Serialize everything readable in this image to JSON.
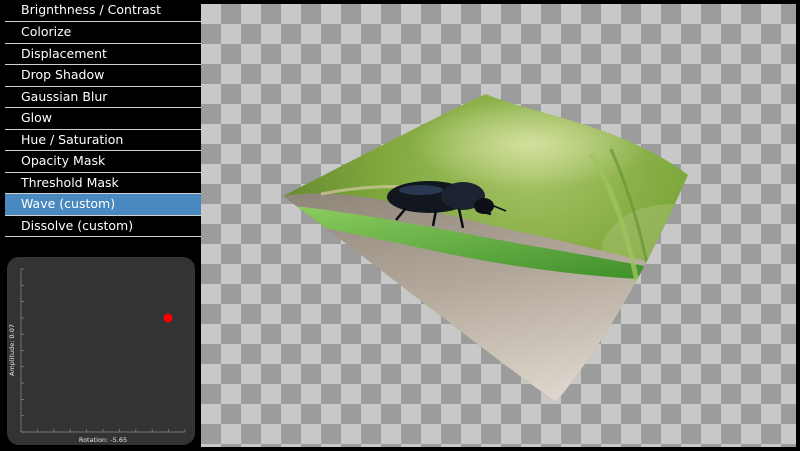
{
  "effects": {
    "items": [
      {
        "label": "Brignthness / Contrast",
        "selected": false
      },
      {
        "label": "Colorize",
        "selected": false
      },
      {
        "label": "Displacement",
        "selected": false
      },
      {
        "label": "Drop Shadow",
        "selected": false
      },
      {
        "label": "Gaussian Blur",
        "selected": false
      },
      {
        "label": "Glow",
        "selected": false
      },
      {
        "label": "Hue / Saturation",
        "selected": false
      },
      {
        "label": "Opacity Mask",
        "selected": false
      },
      {
        "label": "Threshold Mask",
        "selected": false
      },
      {
        "label": "Wave (custom)",
        "selected": true
      },
      {
        "label": "Dissolve (custom)",
        "selected": false
      }
    ],
    "selected_color": "#4a88c0"
  },
  "control_pad": {
    "x_label": "Rotation: -5.65",
    "y_label": "Amplitude: 0.07",
    "handle_color": "#ff0000"
  },
  "canvas": {
    "image_subject": "beetle-on-leaf-photo",
    "effect_applied": "Wave (custom)"
  }
}
